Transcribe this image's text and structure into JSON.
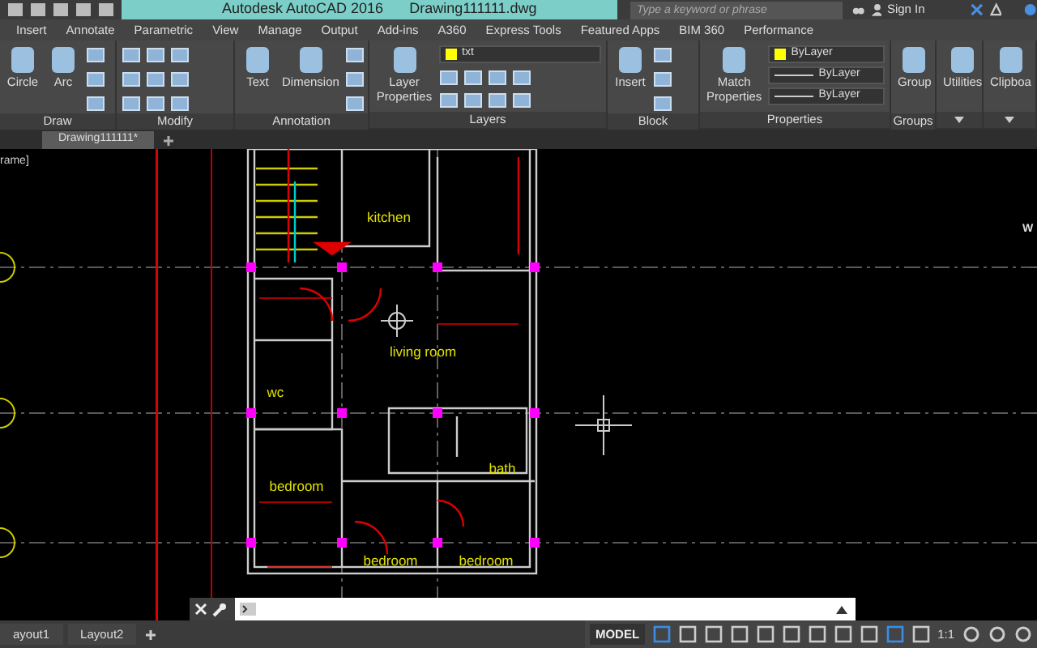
{
  "title_bar": {
    "app_title": "Autodesk AutoCAD 2016",
    "file_name": "Drawing111111.dwg",
    "search_placeholder": "Type a keyword or phrase",
    "sign_in": "Sign In"
  },
  "ribbon_tabs": [
    "Insert",
    "Annotate",
    "Parametric",
    "View",
    "Manage",
    "Output",
    "Add-ins",
    "A360",
    "Express Tools",
    "Featured Apps",
    "BIM 360",
    "Performance"
  ],
  "ribbon_panels": [
    {
      "title": "Draw",
      "tools": [
        "Circle",
        "Arc"
      ]
    },
    {
      "title": "Modify"
    },
    {
      "title": "Annotation",
      "tools": [
        "Text",
        "Dimension"
      ]
    },
    {
      "title": "Layers",
      "tools": [
        "Layer Properties"
      ],
      "layer": "txt"
    },
    {
      "title": "Block",
      "tools": [
        "Insert"
      ]
    },
    {
      "title": "Properties",
      "tools": [
        "Match Properties"
      ],
      "combos": [
        "ByLayer",
        "ByLayer",
        "ByLayer"
      ]
    },
    {
      "title": "Groups",
      "tools": [
        "Group"
      ]
    },
    {
      "tools": [
        "Utilities"
      ]
    },
    {
      "tools": [
        "Clipboa"
      ]
    }
  ],
  "document_tabs": [
    {
      "label": "Drawing111111*",
      "selected": true
    }
  ],
  "viewport_label": "rame]",
  "viewcube_label": "W",
  "rooms": [
    "kitchen",
    "living room",
    "wc",
    "bath",
    "bedroom",
    "bedroom",
    "bedroom"
  ],
  "layout_tabs": [
    "ayout1",
    "Layout2"
  ],
  "status_bar": {
    "model": "MODEL",
    "scale": "1:1"
  }
}
